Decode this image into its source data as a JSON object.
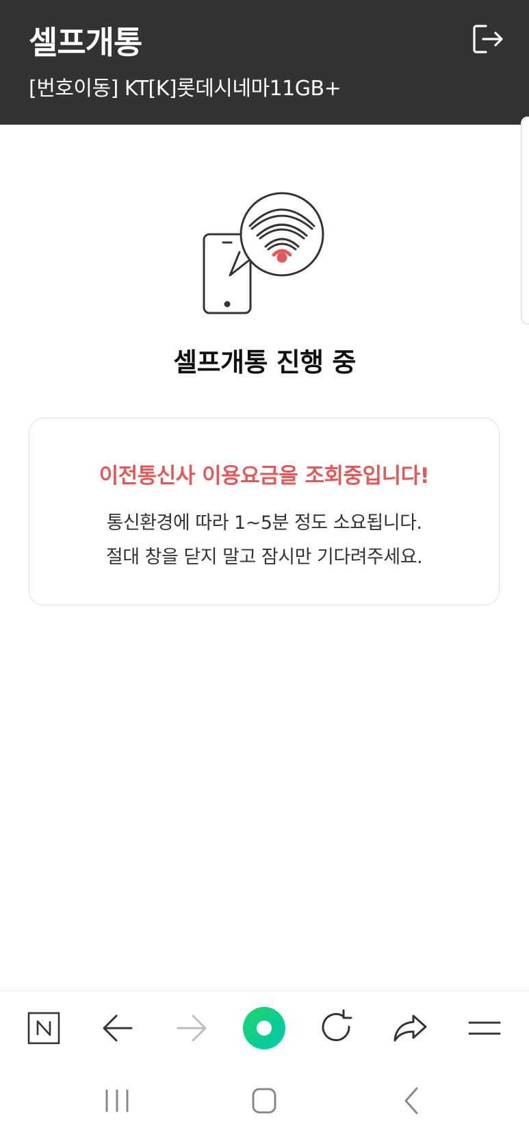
{
  "header": {
    "title": "셀프개통",
    "subtitle": "[번호이동] KT[K]롯데시네마11GB+",
    "exit_icon": "logout-icon"
  },
  "main": {
    "illustration_icon": "phone-wifi-signal-icon",
    "progress_title": "셀프개통 진행 중",
    "notice": {
      "headline": "이전통신사 이용요금을 조회중입니다!",
      "line1": "통신환경에 따라 1~5분 정도 소요됩니다.",
      "line2": "절대 창을 닫지 말고 잠시만 기다려주세요."
    }
  },
  "browser_bar": {
    "icons": [
      "naver-icon",
      "back-arrow-icon",
      "forward-arrow-icon",
      "green-dot-home-icon",
      "refresh-icon",
      "share-icon",
      "menu-icon"
    ]
  },
  "system_nav": {
    "icons": [
      "recent-apps-icon",
      "home-icon",
      "back-icon"
    ]
  },
  "colors": {
    "header_bg": "#333333",
    "accent_red": "#e05a5a",
    "brand_green": "#03c75a"
  }
}
